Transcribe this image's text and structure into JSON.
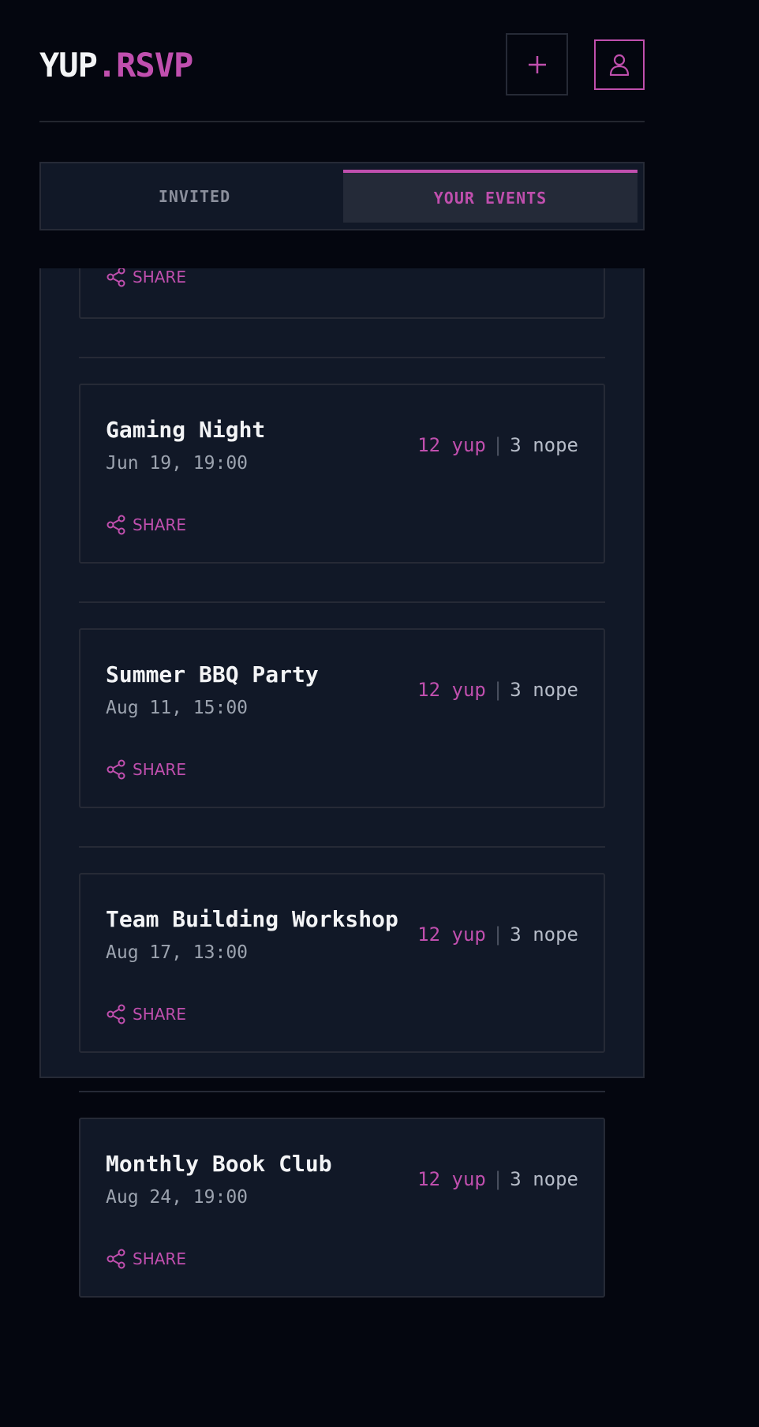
{
  "app": {
    "logo_main": "YUP",
    "logo_accent": ".RSVP"
  },
  "header": {
    "add_icon": "plus-icon",
    "user_icon": "user-icon"
  },
  "tabs": [
    {
      "label": "INVITED",
      "active": false
    },
    {
      "label": "YOUR EVENTS",
      "active": true
    }
  ],
  "share_label": "SHARE",
  "events": [
    {
      "title": "Gaming Night",
      "date": "Jun 19, 19:00",
      "yup": "12 yup",
      "sep": "|",
      "nope": "3 nope"
    },
    {
      "title": "Summer BBQ Party",
      "date": "Aug 11, 15:00",
      "yup": "12 yup",
      "sep": "|",
      "nope": "3 nope"
    },
    {
      "title": "Team Building Workshop",
      "date": "Aug 17, 13:00",
      "yup": "12 yup",
      "sep": "|",
      "nope": "3 nope"
    },
    {
      "title": "Monthly Book Club",
      "date": "Aug 24, 19:00",
      "yup": "12 yup",
      "sep": "|",
      "nope": "3 nope"
    }
  ],
  "colors": {
    "accent": "#c04fae",
    "background": "#04060f",
    "card": "#111827",
    "border": "#262a36"
  }
}
